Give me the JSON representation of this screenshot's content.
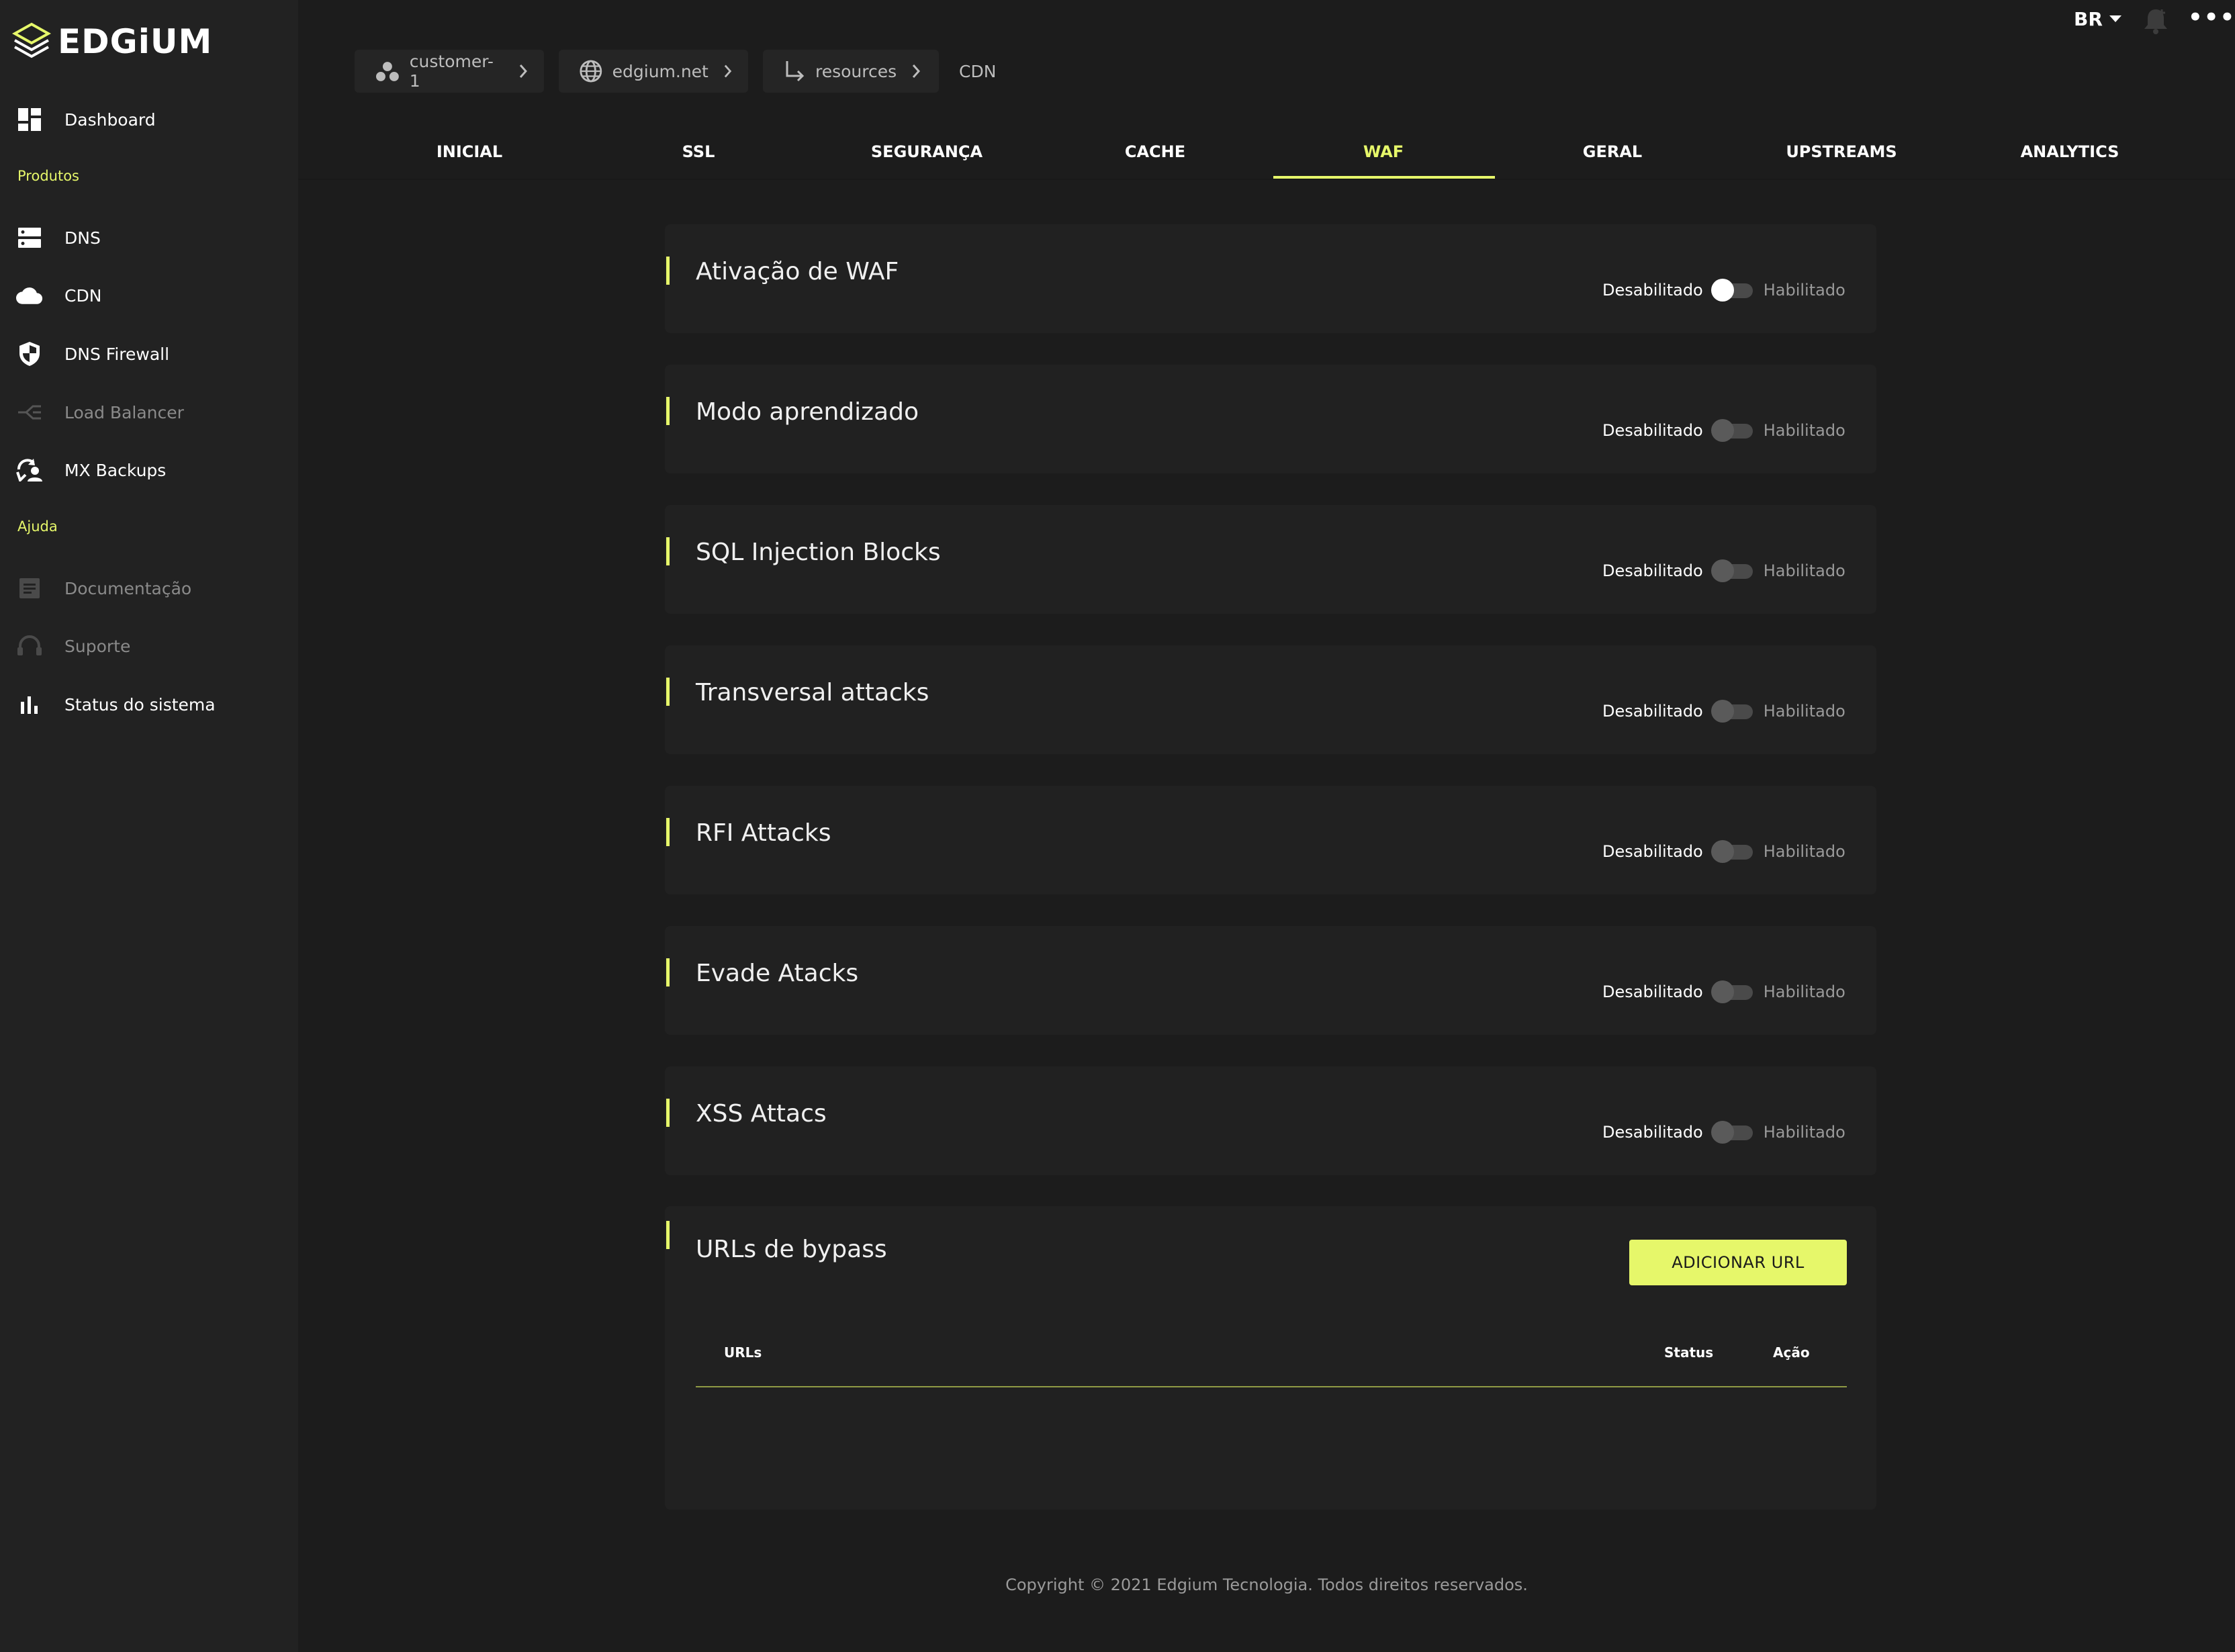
{
  "brand": {
    "name": "EDGiUM",
    "accent": "#e6f76a"
  },
  "sidebar": {
    "dashboard": "Dashboard",
    "section_products": "Produtos",
    "items": [
      {
        "label": "DNS",
        "icon": "dns-server-icon",
        "enabled": true
      },
      {
        "label": "CDN",
        "icon": "cloud-icon",
        "enabled": true
      },
      {
        "label": "DNS Firewall",
        "icon": "shield-icon",
        "enabled": true
      },
      {
        "label": "Load Balancer",
        "icon": "load-balancer-icon",
        "enabled": false
      },
      {
        "label": "MX Backups",
        "icon": "mail-backup-icon",
        "enabled": true
      }
    ],
    "section_help": "Ajuda",
    "help_items": [
      {
        "label": "Documentação",
        "icon": "document-icon",
        "enabled": false
      },
      {
        "label": "Suporte",
        "icon": "headset-icon",
        "enabled": false
      },
      {
        "label": "Status do sistema",
        "icon": "bar-chart-icon",
        "enabled": true
      }
    ]
  },
  "topbar": {
    "language": "BR",
    "more": "•••"
  },
  "breadcrumb": {
    "customer": "customer-1",
    "domain": "edgium.net",
    "resources": "resources",
    "current": "CDN"
  },
  "tabs": [
    "INICIAL",
    "SSL",
    "SEGURANÇA",
    "CACHE",
    "WAF",
    "GERAL",
    "UPSTREAMS",
    "ANALYTICS"
  ],
  "active_tab": "WAF",
  "toggle_labels": {
    "off": "Desabilitado",
    "on": "Habilitado"
  },
  "settings": [
    {
      "title": "Ativação de WAF",
      "enabled": false
    },
    {
      "title": "Modo aprendizado",
      "enabled": false
    },
    {
      "title": "SQL Injection Blocks",
      "enabled": false
    },
    {
      "title": "Transversal attacks",
      "enabled": false
    },
    {
      "title": "RFI Attacks",
      "enabled": false
    },
    {
      "title": "Evade Atacks",
      "enabled": false
    },
    {
      "title": "XSS Attacs",
      "enabled": false
    }
  ],
  "bypass": {
    "title": "URLs de bypass",
    "add_button": "ADICIONAR URL",
    "columns": [
      "URLs",
      "Status",
      "Ação"
    ],
    "rows": []
  },
  "footer": "Copyright © 2021 Edgium Tecnologia. Todos direitos reservados."
}
